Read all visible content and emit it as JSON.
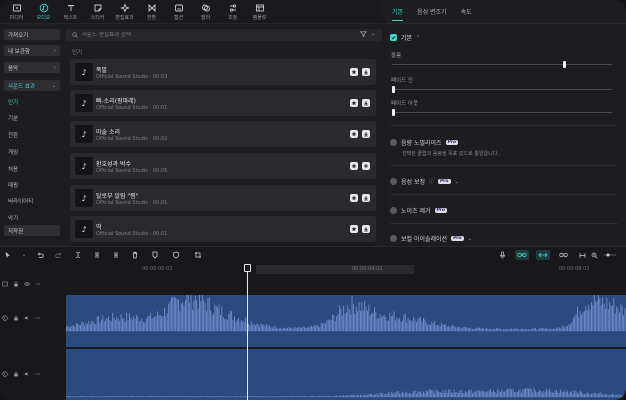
{
  "toolbar": {
    "items": [
      {
        "label": "미디어",
        "icon": "media-icon"
      },
      {
        "label": "오디오",
        "icon": "audio-icon"
      },
      {
        "label": "텍스트",
        "icon": "text-icon"
      },
      {
        "label": "스티커",
        "icon": "sticker-icon"
      },
      {
        "label": "편집효과",
        "icon": "effects-icon"
      },
      {
        "label": "전환",
        "icon": "transition-icon"
      },
      {
        "label": "캡션",
        "icon": "caption-icon"
      },
      {
        "label": "필터",
        "icon": "filter-icon"
      },
      {
        "label": "조정",
        "icon": "adjust-icon"
      },
      {
        "label": "템플릿",
        "icon": "template-icon"
      }
    ],
    "active_index": 1
  },
  "sidebar": {
    "import_label": "가져오기",
    "my_storage_label": "내 보관함",
    "music_label": "음악",
    "sound_effects_label": "사운드 효과",
    "items": [
      "인기",
      "기분",
      "전환",
      "게임",
      "처음",
      "매핑",
      "버라이어티",
      "악기"
    ],
    "copyright_label": "저작권"
  },
  "search": {
    "placeholder": "사운드 편집효과 검색"
  },
  "filter_label": "",
  "main": {
    "section_title": "인기",
    "tracks": [
      {
        "title": "폭발",
        "artist": "Official Sound Studio",
        "duration": "00:03"
      },
      {
        "title": "빠-소리(팡파레)",
        "artist": "Official Sound Studio",
        "duration": "00:01"
      },
      {
        "title": "마술 소리",
        "artist": "Official Sound Studio",
        "duration": "00:02"
      },
      {
        "title": "환호성과 박수",
        "artist": "Official Sound Studio",
        "duration": "00:05"
      },
      {
        "title": "탈로부 알림 \"찡\"",
        "artist": "Official Sound Studio",
        "duration": "00:01"
      },
      {
        "title": "딱",
        "artist": "Official Sound Studio",
        "duration": "00:01"
      }
    ]
  },
  "right": {
    "tabs": [
      "기본",
      "음성 변조기",
      "속도"
    ],
    "active_tab": 0,
    "basic_label": "기본",
    "volume_label": "볼륨",
    "fade_in_label": "페이드 인",
    "fade_out_label": "페이드 아웃",
    "volume_level": 0.78,
    "fade_in_level": 0,
    "fade_out_level": 0,
    "normalize_label": "음량 노멀라이즈",
    "normalize_desc": "선택된 클립의 음량을 목표 값으로 통일합니다.",
    "enhance_label": "음성 보정",
    "denoise_label": "노이즈 제거",
    "isolate_label": "보컬 아이솔레이션",
    "pro_label": "Pro"
  },
  "timeline": {
    "times": [
      "00:00:00:02",
      "00:00:04:02",
      "00:00:08:02"
    ]
  },
  "colors": {
    "accent": "#3ed6d6",
    "clip": "#2b4a7e",
    "waveform": "#6f8fd0"
  }
}
